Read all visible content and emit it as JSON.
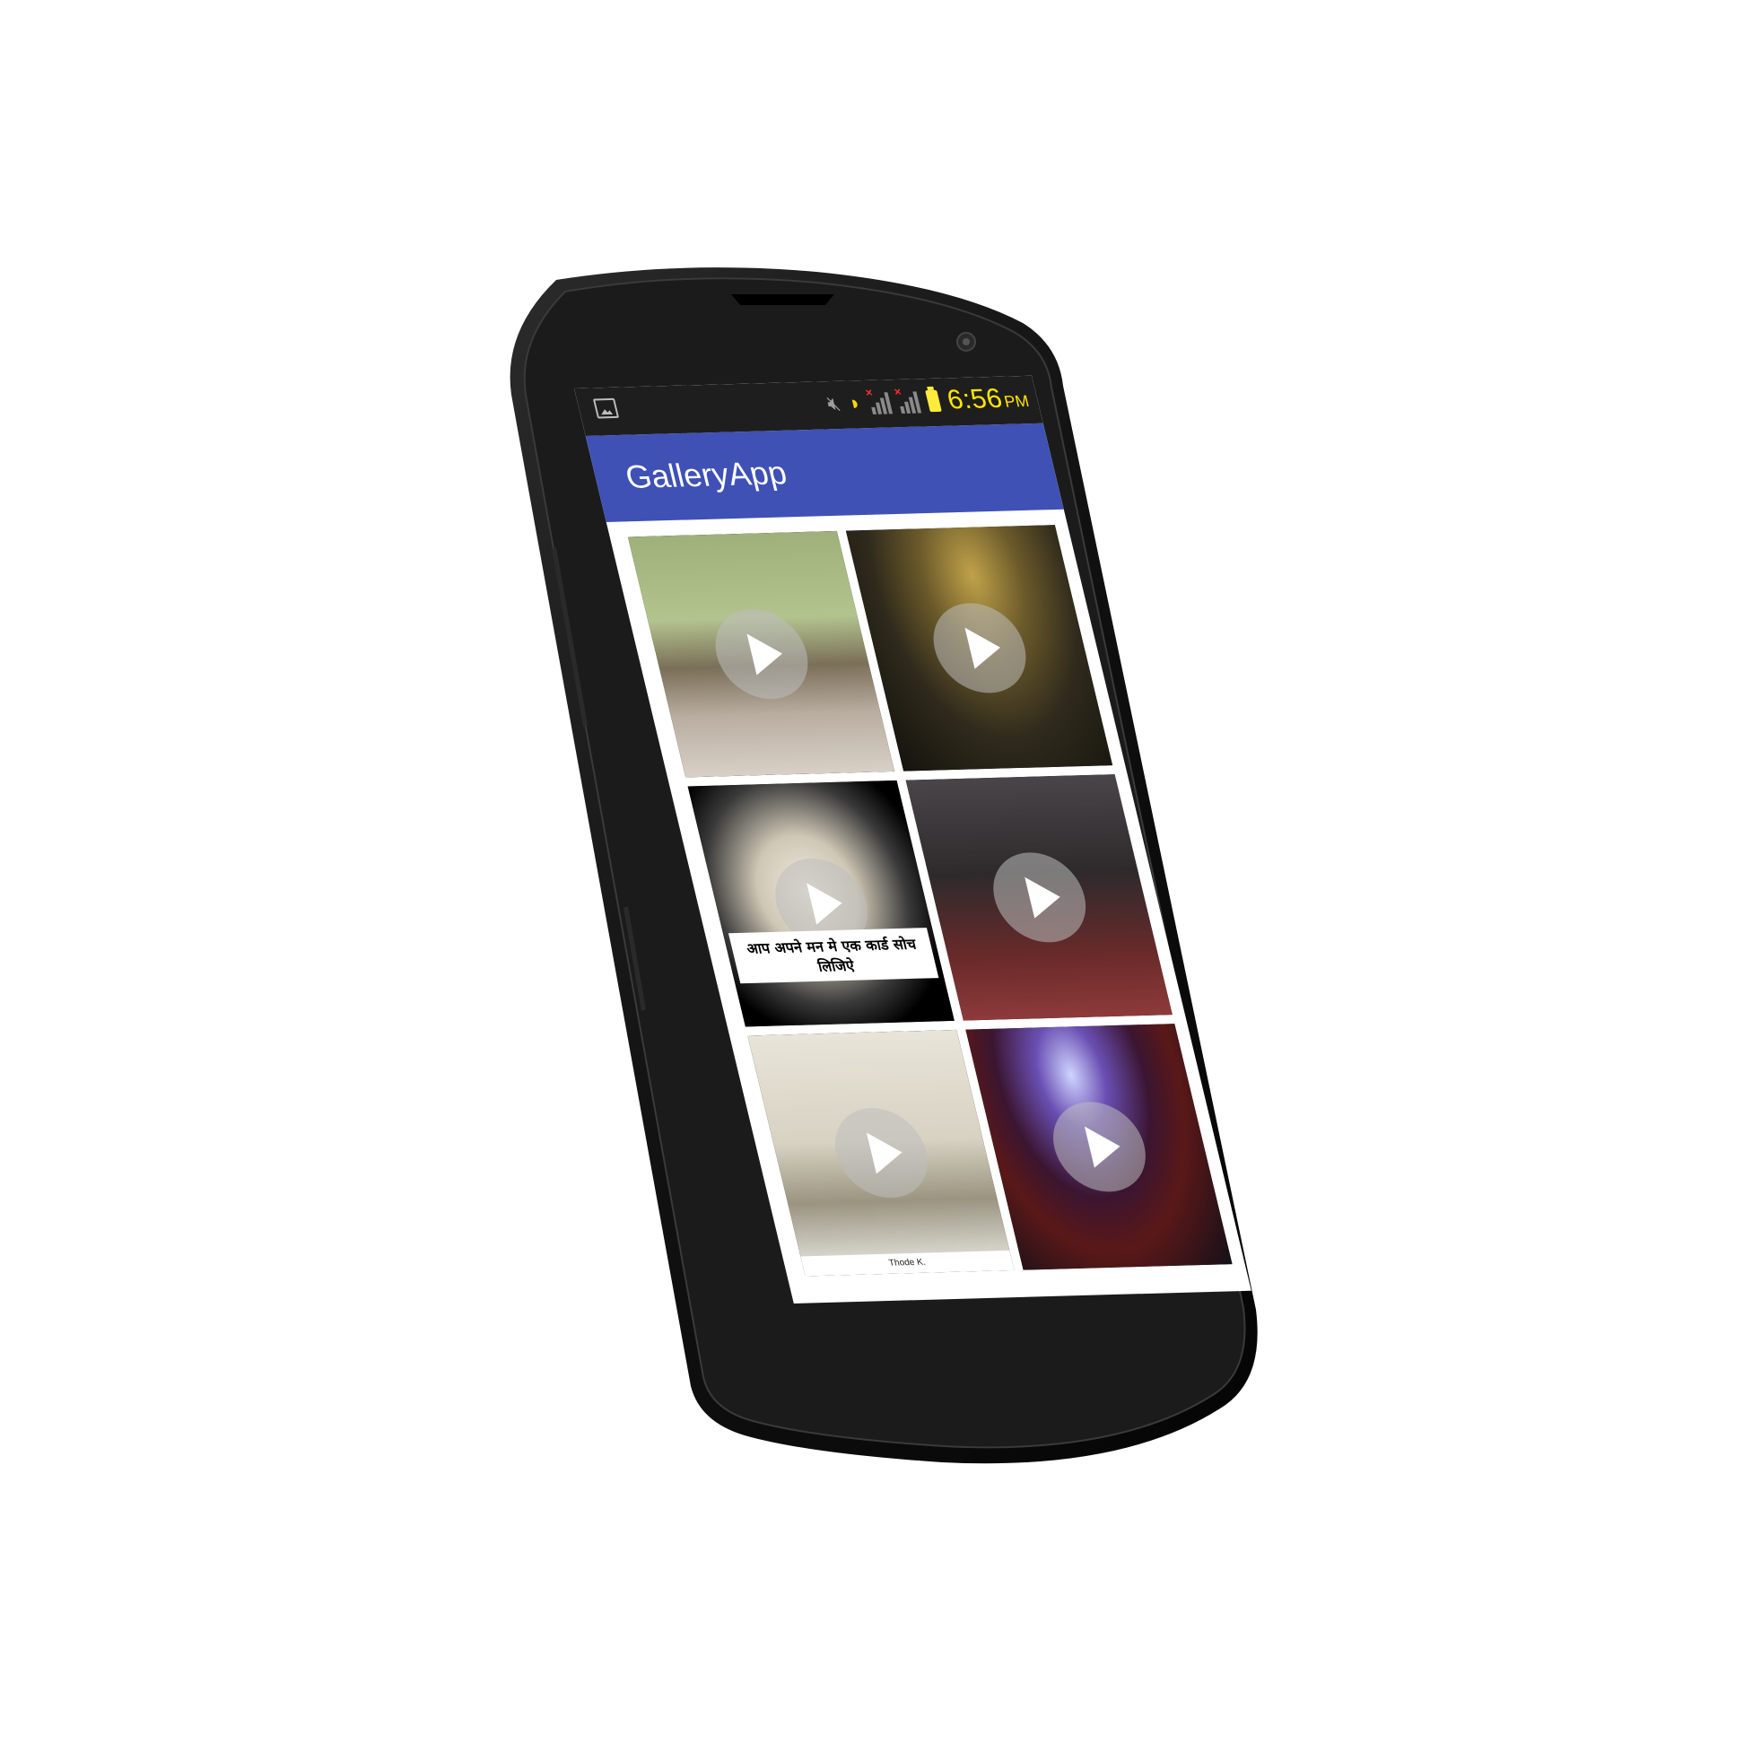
{
  "status_bar": {
    "time": "6:56",
    "ampm": "PM"
  },
  "app_bar": {
    "title": "GalleryApp"
  },
  "videos": [
    {
      "caption": ""
    },
    {
      "caption": ""
    },
    {
      "caption": "आप अपने मन मे एक कार्ड सोच लिजिऐ"
    },
    {
      "caption": ""
    },
    {
      "caption": "Thode K."
    },
    {
      "caption": ""
    }
  ],
  "icons": {
    "status": [
      "image-notification-icon",
      "mute-icon",
      "wifi-icon",
      "signal-x-icon",
      "signal-x-icon",
      "battery-icon"
    ],
    "tile": "play-icon"
  },
  "colors": {
    "app_bar": "#3f51b5",
    "status_bar": "#1e1e1e",
    "clock": "#ffe600",
    "phone_body": "#0d0d0d"
  }
}
